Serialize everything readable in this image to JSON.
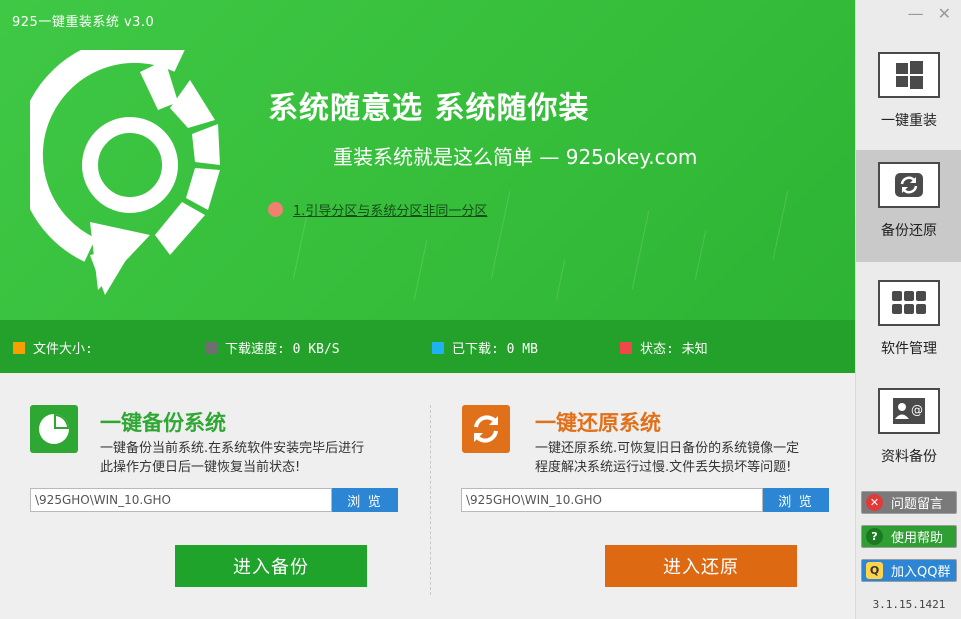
{
  "window": {
    "title": "925一键重装系统 v3.0",
    "minimize_glyph": "—",
    "close_glyph": "✕"
  },
  "hero": {
    "slogan": "系统随意选 系统随你装",
    "subslogan": "重装系统就是这么简单 — 925okey.com",
    "notice": "1.引导分区与系统分区非同一分区"
  },
  "status": {
    "file_size": {
      "label": "文件大小:",
      "color": "#f5a000"
    },
    "speed": {
      "label": "下载速度: 0 KB/S",
      "color": "#6f6f6f"
    },
    "downloaded": {
      "label": "已下载: 0 MB",
      "color": "#1eb2f0"
    },
    "state": {
      "label": "状态: 未知",
      "color": "#f04848"
    }
  },
  "backup": {
    "title": "一键备份系统",
    "desc_line1": "一键备份当前系统.在系统软件安装完毕后进行",
    "desc_line2": "此操作方便日后一键恢复当前状态!",
    "path": "\\925GHO\\WIN_10.GHO",
    "browse_label": "浏 览",
    "action_label": "进入备份",
    "accent": "#2ea833",
    "icon": "pie-chart-icon"
  },
  "restore": {
    "title": "一键还原系统",
    "desc_line1": "一键还原系统.可恢复旧日备份的系统镜像一定",
    "desc_line2": "程度解决系统运行过慢.文件丢失损坏等问题!",
    "path": "\\925GHO\\WIN_10.GHO",
    "browse_label": "浏 览",
    "action_label": "进入还原",
    "accent": "#e0711a",
    "icon": "refresh-icon"
  },
  "sidebar": {
    "nav": [
      {
        "label": "一键重装",
        "icon": "windows-icon",
        "active": false
      },
      {
        "label": "备份还原",
        "icon": "sync-icon",
        "active": true
      },
      {
        "label": "软件管理",
        "icon": "grid-icon",
        "active": false
      },
      {
        "label": "资料备份",
        "icon": "profile-card-icon",
        "active": false
      }
    ],
    "feedback_label": "问题留言",
    "help_label": "使用帮助",
    "qq_label": "加入QQ群",
    "version": "3.1.15.1421"
  }
}
